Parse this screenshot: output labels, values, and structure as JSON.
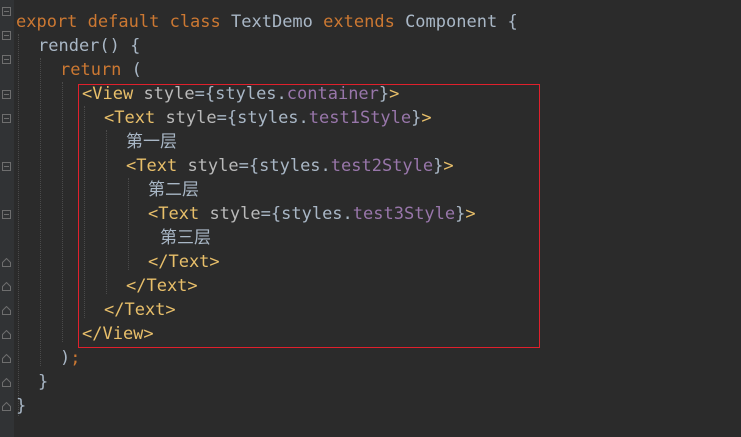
{
  "code": {
    "l1": {
      "kw1": "export",
      "kw2": "default",
      "kw3": "class",
      "name": "TextDemo",
      "kw4": "extends",
      "base": "Component",
      "brace": "{"
    },
    "l2": {
      "text": "render() {"
    },
    "l3": {
      "kw": "return",
      "paren": "("
    },
    "l4": {
      "open": "<View",
      "attr": "style",
      "eq": "=",
      "ob": "{",
      "obj": "styles.",
      "prop": "container",
      "cb": "}",
      "close": ">"
    },
    "l5": {
      "open": "<Text",
      "attr": "style",
      "eq": "=",
      "ob": "{",
      "obj": "styles.",
      "prop": "test1Style",
      "cb": "}",
      "close": ">"
    },
    "l6": {
      "text": "第一层"
    },
    "l7": {
      "open": "<Text",
      "attr": "style",
      "eq": "=",
      "ob": "{",
      "obj": "styles.",
      "prop": "test2Style",
      "cb": "}",
      "close": ">"
    },
    "l8": {
      "text": "第二层"
    },
    "l9": {
      "open": "<Text",
      "attr": "style",
      "eq": "=",
      "ob": "{",
      "obj": "styles.",
      "prop": "test3Style",
      "cb": "}",
      "close": ">"
    },
    "l10": {
      "text": "第三层"
    },
    "l11": {
      "text": "</Text>"
    },
    "l12": {
      "text": "</Text>"
    },
    "l13": {
      "text": "</Text>"
    },
    "l14": {
      "text": "</View>"
    },
    "l15": {
      "paren": ")",
      "semi": ";"
    },
    "l16": {
      "text": "}"
    },
    "l17": {
      "text": "}"
    }
  },
  "colors": {
    "background": "#2b2b2b",
    "keyword": "#cc7832",
    "tag": "#e8bf6a",
    "property": "#9876aa",
    "text": "#a9b7c6",
    "highlight": "#e0202c"
  },
  "icons": [
    "fold-open-icon",
    "fold-close-icon"
  ]
}
